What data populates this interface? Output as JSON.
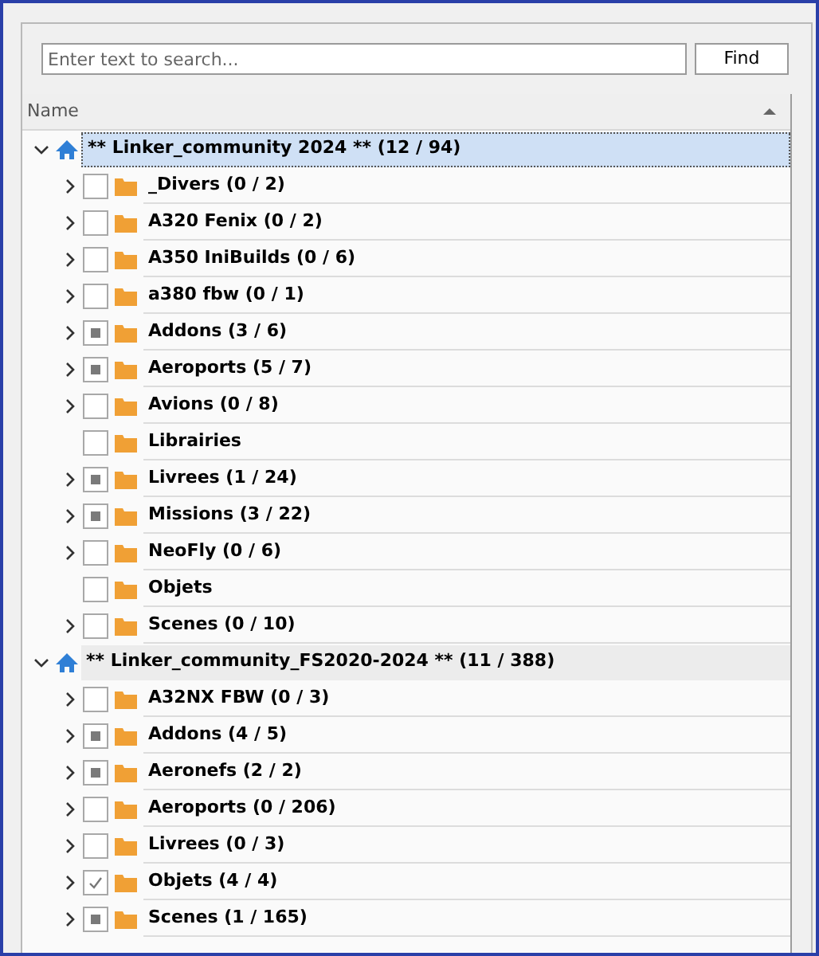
{
  "search": {
    "placeholder": "Enter text to search...",
    "button": "Find"
  },
  "tree": {
    "column": "Name",
    "sort_ascending": true,
    "roots": [
      {
        "label": "** Linker_community 2024 ** (12 / 94)",
        "selected": true,
        "expanded": true,
        "children": [
          {
            "label": "_Divers (0 / 2)",
            "expandable": true,
            "checked": false,
            "partial": false
          },
          {
            "label": "A320 Fenix (0 / 2)",
            "expandable": true,
            "checked": false,
            "partial": false
          },
          {
            "label": "A350 IniBuilds (0 / 6)",
            "expandable": true,
            "checked": false,
            "partial": false
          },
          {
            "label": "a380 fbw (0 / 1)",
            "expandable": true,
            "checked": false,
            "partial": false
          },
          {
            "label": "Addons (3 / 6)",
            "expandable": true,
            "checked": true,
            "partial": true
          },
          {
            "label": "Aeroports (5 / 7)",
            "expandable": true,
            "checked": true,
            "partial": true
          },
          {
            "label": "Avions (0 / 8)",
            "expandable": true,
            "checked": false,
            "partial": false
          },
          {
            "label": "Librairies",
            "expandable": false,
            "checked": false,
            "partial": false
          },
          {
            "label": "Livrees (1 / 24)",
            "expandable": true,
            "checked": true,
            "partial": true
          },
          {
            "label": "Missions (3 / 22)",
            "expandable": true,
            "checked": true,
            "partial": true
          },
          {
            "label": "NeoFly (0 / 6)",
            "expandable": true,
            "checked": false,
            "partial": false
          },
          {
            "label": "Objets",
            "expandable": false,
            "checked": false,
            "partial": false
          },
          {
            "label": "Scenes (0 / 10)",
            "expandable": true,
            "checked": false,
            "partial": false
          }
        ]
      },
      {
        "label": "** Linker_community_FS2020-2024 ** (11 / 388)",
        "selected": false,
        "expanded": true,
        "children": [
          {
            "label": "A32NX FBW (0 / 3)",
            "expandable": true,
            "checked": false,
            "partial": false
          },
          {
            "label": "Addons (4 / 5)",
            "expandable": true,
            "checked": true,
            "partial": true
          },
          {
            "label": "Aeronefs (2 / 2)",
            "expandable": true,
            "checked": true,
            "partial": true
          },
          {
            "label": "Aeroports (0 / 206)",
            "expandable": true,
            "checked": false,
            "partial": false
          },
          {
            "label": "Livrees (0 / 3)",
            "expandable": true,
            "checked": false,
            "partial": false
          },
          {
            "label": "Objets (4 / 4)",
            "expandable": true,
            "checked": true,
            "partial": false
          },
          {
            "label": "Scenes (1 / 165)",
            "expandable": true,
            "checked": true,
            "partial": true
          }
        ]
      }
    ]
  }
}
